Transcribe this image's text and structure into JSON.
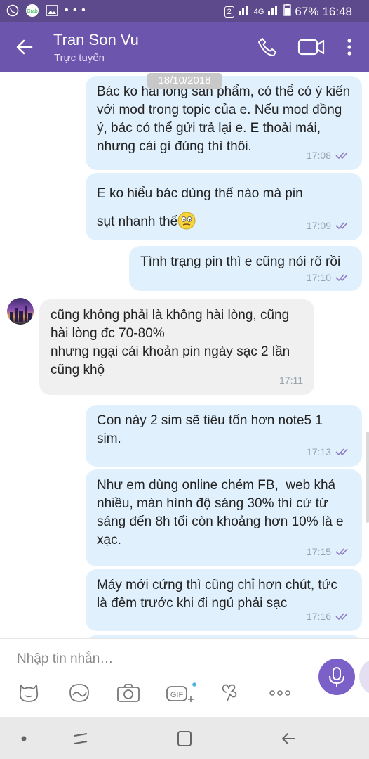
{
  "status_bar": {
    "sim": "2",
    "network": "4G",
    "battery": "67%",
    "time": "16:48",
    "app_icons": [
      "viber-icon",
      "grab-icon",
      "gallery-icon",
      "more-dots-icon"
    ]
  },
  "header": {
    "contact_name": "Tran Son Vu",
    "contact_status": "Trực tuyến",
    "accent": "#6b55ad"
  },
  "chat": {
    "date_chip": "18/10/2018",
    "messages": [
      {
        "dir": "out",
        "text": "Bác ko hài lòng sản phẩm, có thể có ý kiến với mod trong topic của e. Nếu mod đồng ý, bác có thể gửi trả lại e. E thoải mái, nhưng cái gì đúng thì thôi.",
        "time": "17:08"
      },
      {
        "dir": "out",
        "text": "E ko hiểu bác dùng thế nào mà pin sụt nhanh thế",
        "emoji": "confused-face-emoji",
        "time": "17:09"
      },
      {
        "dir": "out",
        "text": "Tình trạng pin thì e cũng nói rõ rồi",
        "time": "17:10"
      },
      {
        "dir": "in",
        "text": "cũng không phải là không hài lòng, cũng hài lòng đc 70-80%\nnhưng ngại cái khoản pin ngày sạc 2 lần cũng khộ",
        "time": "17:11"
      },
      {
        "dir": "out",
        "text": "Con này 2 sim sẽ tiêu tốn hơn note5 1 sim.",
        "time": "17:13"
      },
      {
        "dir": "out",
        "text": "Như em dùng online chém FB,  web khá nhiều, màn hình độ sáng 30% thì cứ từ sáng đến 8h tối còn khoảng hơn 10% là e xạc.",
        "time": "17:15"
      },
      {
        "dir": "out",
        "text": "Máy mới cứng thì cũng chỉ hơn chút, tức là đêm trước khi đi ngủ phải sạc",
        "time": "17:16"
      }
    ],
    "colors": {
      "outgoing": "#e1f0fd",
      "incoming": "#f0f0f0",
      "read_tick": "#8e7cc3"
    }
  },
  "composer": {
    "placeholder": "Nhập tin nhắn…",
    "tools": [
      "sticker-icon",
      "doodle-icon",
      "camera-icon",
      "gif-icon",
      "emoticon-icon",
      "more-options-icon"
    ],
    "gif_label": "GIF"
  },
  "nav": [
    "home-dot-icon",
    "recent-apps-icon",
    "home-icon",
    "back-nav-icon"
  ]
}
